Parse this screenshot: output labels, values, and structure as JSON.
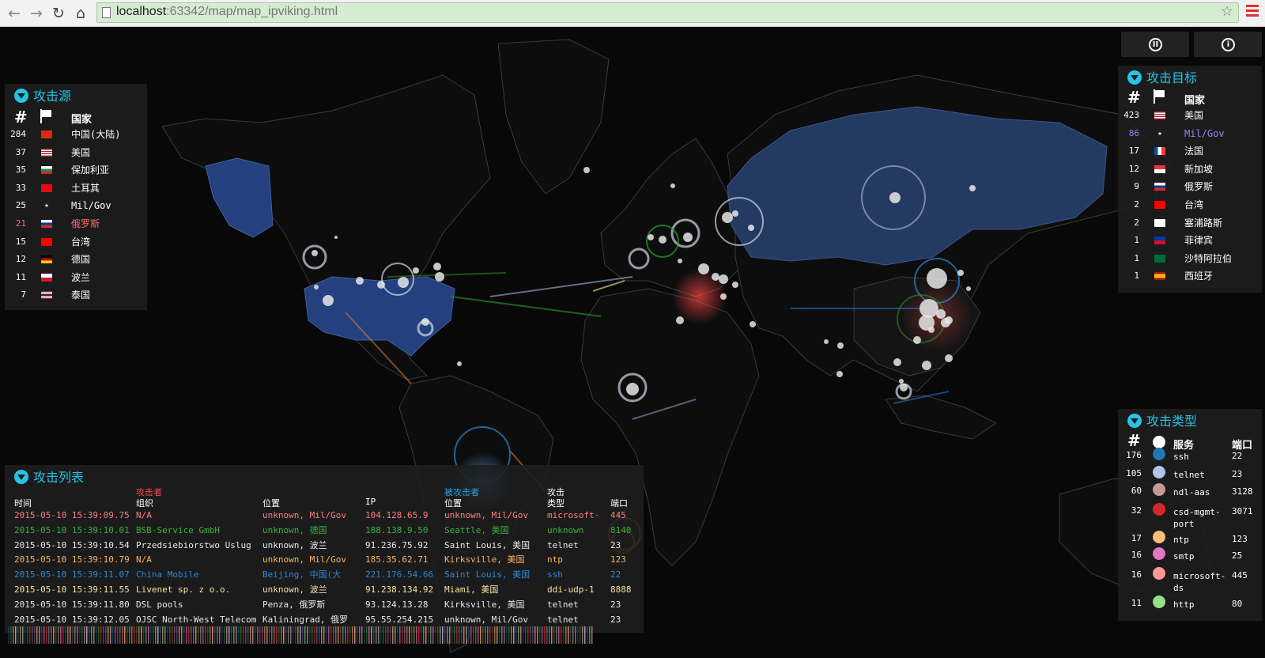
{
  "browser": {
    "url_host": "localhost",
    "url_rest": ":63342/map/map_ipviking.html",
    "back_icon": "back-arrow-icon",
    "forward_icon": "forward-arrow-icon",
    "reload_icon": "reload-icon",
    "home_icon": "home-icon"
  },
  "controls": {
    "pause_glyph": "II",
    "info_glyph": "i"
  },
  "sources": {
    "title": "攻击源",
    "col_country": "国家",
    "rows": [
      {
        "count": "284",
        "flag": "cn",
        "name": "中国(大陆)",
        "color": "#ffffff"
      },
      {
        "count": "37",
        "flag": "us",
        "name": "美国",
        "color": "#ffffff"
      },
      {
        "count": "35",
        "flag": "bg",
        "name": "保加利亚",
        "color": "#ffffff"
      },
      {
        "count": "33",
        "flag": "tr",
        "name": "土耳其",
        "color": "#ffffff"
      },
      {
        "count": "25",
        "flag": "mil",
        "name": "Mil/Gov",
        "color": "#ffffff"
      },
      {
        "count": "21",
        "flag": "ru",
        "name": "俄罗斯",
        "color": "#ff6b6b"
      },
      {
        "count": "15",
        "flag": "tw",
        "name": "台湾",
        "color": "#ffffff"
      },
      {
        "count": "12",
        "flag": "de",
        "name": "德国",
        "color": "#ffffff"
      },
      {
        "count": "11",
        "flag": "pl",
        "name": "波兰",
        "color": "#ffffff"
      },
      {
        "count": "7",
        "flag": "th",
        "name": "泰国",
        "color": "#ffffff"
      }
    ]
  },
  "targets": {
    "title": "攻击目标",
    "col_country": "国家",
    "rows": [
      {
        "count": "423",
        "flag": "us",
        "name": "美国",
        "color": "#ffffff"
      },
      {
        "count": "86",
        "flag": "mil",
        "name": "Mil/Gov",
        "color": "#8a8cf0"
      },
      {
        "count": "17",
        "flag": "fr",
        "name": "法国",
        "color": "#ffffff"
      },
      {
        "count": "12",
        "flag": "sg",
        "name": "新加坡",
        "color": "#ffffff"
      },
      {
        "count": "9",
        "flag": "ru",
        "name": "俄罗斯",
        "color": "#ffffff"
      },
      {
        "count": "2",
        "flag": "tw",
        "name": "台湾",
        "color": "#ffffff"
      },
      {
        "count": "2",
        "flag": "cy",
        "name": "塞浦路斯",
        "color": "#ffffff"
      },
      {
        "count": "1",
        "flag": "ph",
        "name": "菲律宾",
        "color": "#ffffff"
      },
      {
        "count": "1",
        "flag": "sa",
        "name": "沙特阿拉伯",
        "color": "#ffffff"
      },
      {
        "count": "1",
        "flag": "es",
        "name": "西班牙",
        "color": "#ffffff"
      }
    ]
  },
  "types": {
    "title": "攻击类型",
    "col_service": "服务",
    "col_port": "端口",
    "rows": [
      {
        "count": "176",
        "color": "#1f77b4",
        "service": "ssh",
        "service2": "",
        "port": "22"
      },
      {
        "count": "105",
        "color": "#aec7e8",
        "service": "telnet",
        "service2": "",
        "port": "23"
      },
      {
        "count": "60",
        "color": "#c49c94",
        "service": "ndl-aas",
        "service2": "",
        "port": "3128"
      },
      {
        "count": "32",
        "color": "#d62728",
        "service": "csd-mgmt-",
        "service2": "port",
        "port": "3071"
      },
      {
        "count": "17",
        "color": "#ffbb78",
        "service": "ntp",
        "service2": "",
        "port": "123"
      },
      {
        "count": "16",
        "color": "#e377c2",
        "service": "smtp",
        "service2": "",
        "port": "25"
      },
      {
        "count": "16",
        "color": "#ff9896",
        "service": "microsoft-",
        "service2": "ds",
        "port": "445"
      },
      {
        "count": "11",
        "color": "#98df8a",
        "service": "http",
        "service2": "",
        "port": "80"
      }
    ]
  },
  "attacks": {
    "title": "攻击列表",
    "attacker_label": "攻击者",
    "target_label": "被攻击者",
    "col_time": "时间",
    "col_org": "组织",
    "col_loc": "位置",
    "col_ip": "IP",
    "col_tloc": "位置",
    "col_type1": "攻击",
    "col_type2": "类型",
    "col_port": "端口",
    "rows": [
      {
        "time": "2015-05-10 15:39:09.75",
        "org": "N/A",
        "loc": "unknown, Mil/Gov",
        "ip": "104.128.65.9",
        "tloc": "unknown, Mil/Gov",
        "type": "microsoft-",
        "port": "445",
        "color": "#ff7f7f"
      },
      {
        "time": "2015-05-10 15:39:10.01",
        "org": "BSB-Service GmbH",
        "loc": "unknown, 德国",
        "ip": "188.138.9.50",
        "tloc": "Seattle, 美国",
        "type": "unknown",
        "port": "8140",
        "color": "#3cb13c"
      },
      {
        "time": "2015-05-10 15:39:10.54",
        "org": "Przedsiebiorstwo Uslug",
        "loc": "unknown, 波兰",
        "ip": "91.236.75.92",
        "tloc": "Saint Louis, 美国",
        "type": "telnet",
        "port": "23",
        "color": "#e8e8e8"
      },
      {
        "time": "2015-05-10 15:39:10.79",
        "org": "N/A",
        "loc": "unknown, Mil/Gov",
        "ip": "185.35.62.71",
        "tloc": "Kirksville, 美国",
        "type": "ntp",
        "port": "123",
        "color": "#ffb163"
      },
      {
        "time": "2015-05-10 15:39:11.07",
        "org": "China Mobile",
        "loc": "Beijing, 中国(大",
        "ip": "221.176.54.66",
        "tloc": "Saint Louis, 美国",
        "type": "ssh",
        "port": "22",
        "color": "#2a8ad6"
      },
      {
        "time": "2015-05-10 15:39:11.55",
        "org": "Livenet sp. z o.o.",
        "loc": "unknown, 波兰",
        "ip": "91.238.134.92",
        "tloc": "Miami, 美国",
        "type": "ddi-udp-1",
        "port": "8888",
        "color": "#f4e2a0"
      },
      {
        "time": "2015-05-10 15:39:11.80",
        "org": "DSL pools",
        "loc": "Penza, 俄罗斯",
        "ip": "93.124.13.28",
        "tloc": "Kirksville, 美国",
        "type": "telnet",
        "port": "23",
        "color": "#e8e8e8"
      },
      {
        "time": "2015-05-10 15:39:12.05",
        "org": "OJSC North-West Telecom",
        "loc": "Kaliningrad, 俄罗",
        "ip": "95.55.254.215",
        "tloc": "unknown, Mil/Gov",
        "type": "telnet",
        "port": "23",
        "color": "#e8e8e8"
      }
    ]
  }
}
